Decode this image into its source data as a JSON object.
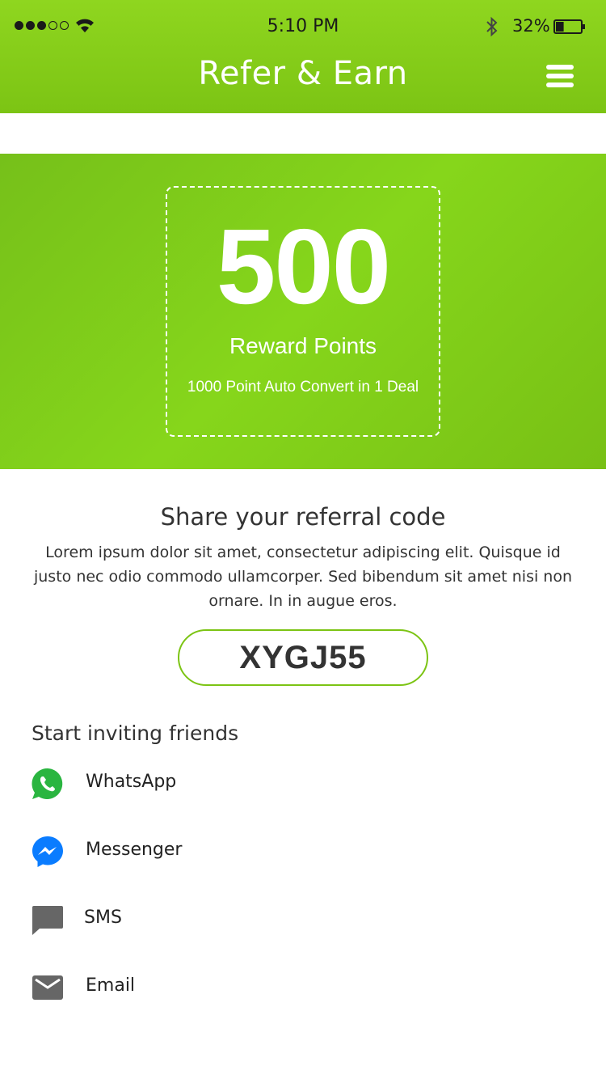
{
  "status_bar": {
    "time": "5:10 PM",
    "battery": "32%",
    "signal_bars_full": 3,
    "signal_bars_total": 5,
    "battery_level": 0.32
  },
  "header": {
    "title": "Refer & Earn",
    "menu_icon": "hamburger-menu-icon",
    "background": "#7cc414"
  },
  "reward": {
    "points": "500",
    "label": "Reward Points",
    "note": "1000 Point Auto Convert in 1 Deal"
  },
  "share": {
    "title": "Share your referral code",
    "description": "Lorem ipsum dolor sit amet, consectetur adipiscing elit. Quisque id justo nec odio commodo ullamcorper. Sed bibendum sit amet nisi non ornare. In in augue eros.",
    "code": "XYGJ55",
    "accent": "#7cc414"
  },
  "invite": {
    "title": "Start inviting friends",
    "items": [
      {
        "label": "WhatsApp",
        "icon": "whatsapp-icon",
        "color": "#2ab540"
      },
      {
        "label": "Messenger",
        "icon": "messenger-icon",
        "color": "#0a7cff"
      },
      {
        "label": "SMS",
        "icon": "sms-icon",
        "color": "#666666"
      },
      {
        "label": "Email",
        "icon": "email-icon",
        "color": "#666666"
      }
    ]
  }
}
